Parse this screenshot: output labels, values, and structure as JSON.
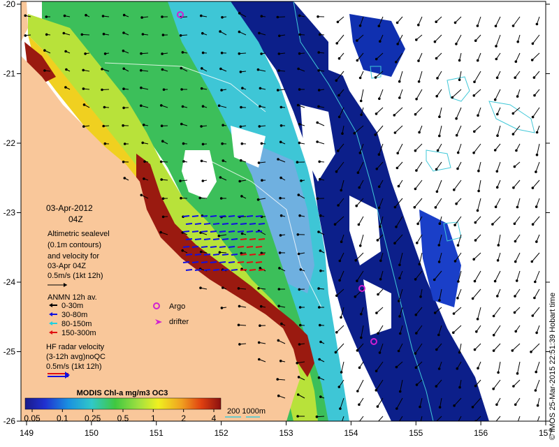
{
  "map": {
    "date_line": "03-Apr-2012",
    "time_line": "04Z",
    "altimetry_lines": [
      "Altimetric sealevel",
      "(0.1m contours)",
      "and velocity for",
      "03-Apr 04Z",
      "0.5m/s (1kt 12h)"
    ],
    "anmn_title": "ANMN 12h av.",
    "anmn_depths": [
      {
        "label": "0-30m",
        "color": "#000000"
      },
      {
        "label": "30-80m",
        "color": "#1010e0"
      },
      {
        "label": "80-150m",
        "color": "#20d0e0"
      },
      {
        "label": "150-300m",
        "color": "#e01010"
      }
    ],
    "argo_label": "Argo",
    "drifter_label": "drifter",
    "hf_lines": [
      "HF radar velocity",
      "(3-12h avg)noQC",
      "0.5m/s (1kt 12h)"
    ],
    "colorbar_title": "MODIS Chl-a mg/m3 OC3",
    "colorbar_ticks": [
      "0.05",
      "0.1",
      "0.25",
      "0.5",
      "1",
      "2",
      "4"
    ],
    "bathymetry_label": "200  1000m",
    "credit": "© IMOS 25-Mar-2015 22:51:39 Hobart time",
    "lon_ticks": [
      "149",
      "150",
      "151",
      "152",
      "153",
      "154",
      "155",
      "156",
      "157"
    ],
    "lat_ticks": [
      "-20",
      "-21",
      "-22",
      "-23",
      "-24",
      "-25",
      "-26"
    ],
    "colors": {
      "land": "#f9c79a",
      "deep_ocean_chl": "#0c1f8a",
      "argo": "#d020d0",
      "drifter": "#d020d0",
      "bathy_contour": "#40c8d8"
    }
  }
}
